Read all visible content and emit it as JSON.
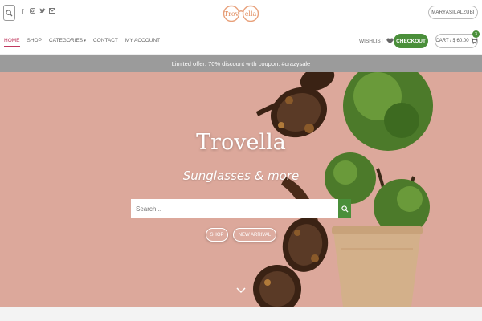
{
  "header": {
    "account_label": "MARYASILALZUBI",
    "social_icons": [
      "facebook-icon",
      "instagram-icon",
      "twitter-icon",
      "envelope-icon"
    ],
    "logo_left": "Trov",
    "logo_right": "ella"
  },
  "nav": {
    "items": [
      "HOME",
      "SHOP",
      "CATEGORIES",
      "CONTACT",
      "MY ACCOUNT"
    ],
    "wishlist_label": "WISHLIST",
    "checkout_label": "CHECKOUT",
    "cart_label": "CART / $ 60.00",
    "cart_count": "3"
  },
  "promo": {
    "text": "Limited offer: 70% discount with coupon: #crazysale"
  },
  "hero": {
    "title": "Trovella",
    "subtitle": "Sunglasses & more",
    "search_placeholder": "Search...",
    "shop_label": "SHOP",
    "new_arrival_label": "NEW ARRIVAL"
  },
  "colors": {
    "accent_green": "#4a8f3a",
    "active_nav": "#c0395f",
    "hero_background": "#dca89b",
    "promo_bar": "#9b9b9b"
  }
}
